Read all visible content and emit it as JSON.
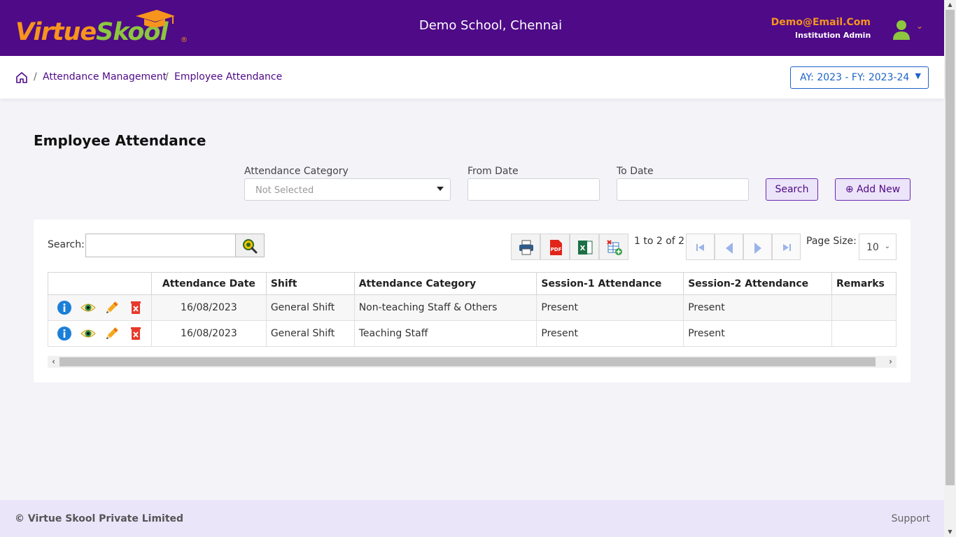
{
  "header": {
    "logo_text_a": "Virtue",
    "logo_text_b": "Skool",
    "logo_reg": "®",
    "school_name": "Demo School, Chennai",
    "user_email": "Demo@Email.Com",
    "user_role": "Institution Admin"
  },
  "breadcrumb": {
    "items": [
      "Attendance Management",
      "Employee Attendance"
    ],
    "separator": "/"
  },
  "academic_year": {
    "label": "AY: 2023 - FY: 2023-24"
  },
  "page": {
    "title": "Employee Attendance"
  },
  "filters": {
    "category_label": "Attendance Category",
    "category_value": "Not Selected",
    "from_label": "From Date",
    "from_value": "",
    "to_label": "To Date",
    "to_value": "",
    "search_button": "Search",
    "add_new_button": "Add New",
    "add_new_icon": "⊕"
  },
  "grid": {
    "search_label": "Search:",
    "search_value": "",
    "pager_info": "1 to 2 of 2",
    "page_size_label": "Page Size:",
    "page_size": "10",
    "tools": [
      "print-icon",
      "pdf-icon",
      "excel-icon",
      "columns-add-icon"
    ],
    "columns": [
      "",
      "Attendance Date",
      "Shift",
      "Attendance Category",
      "Session-1 Attendance",
      "Session-2 Attendance",
      "Remarks"
    ],
    "rows": [
      {
        "date": "16/08/2023",
        "shift": "General Shift",
        "category": "Non-teaching Staff & Others",
        "session1": "Present",
        "session2": "Present",
        "remarks": ""
      },
      {
        "date": "16/08/2023",
        "shift": "General Shift",
        "category": "Teaching Staff",
        "session1": "Present",
        "session2": "Present",
        "remarks": ""
      }
    ]
  },
  "footer": {
    "copyright": "© Virtue Skool Private Limited",
    "support": "Support"
  },
  "colors": {
    "header_bg": "#4e0a87",
    "accent_orange": "#f7941d",
    "accent_green": "#8dc63f",
    "link_blue": "#1e63c8",
    "footer_bg": "#ebe5fa"
  }
}
